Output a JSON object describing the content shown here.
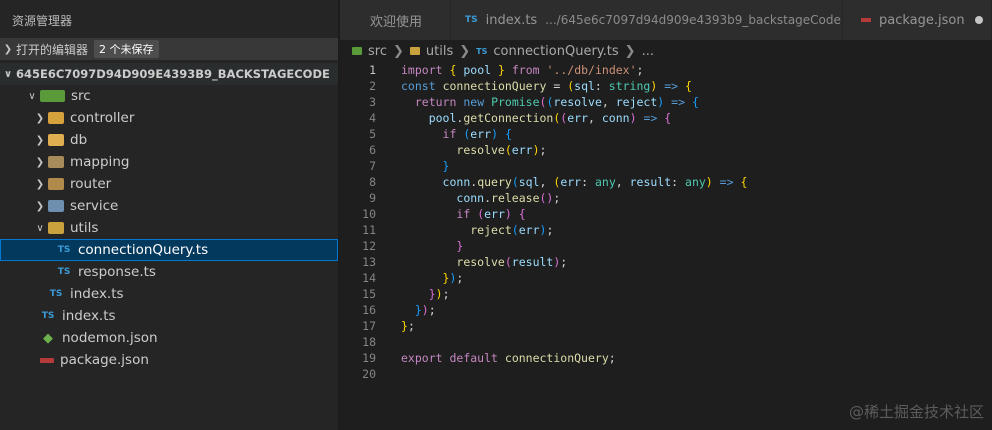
{
  "sidebar": {
    "title": "资源管理器",
    "open_editors": {
      "label": "打开的编辑器",
      "badge": "2 个未保存"
    },
    "root": {
      "label": "645E6C7097D94D909E4393B9_BACKSTAGECODE"
    },
    "tree": [
      {
        "label": "src"
      },
      {
        "label": "controller"
      },
      {
        "label": "db"
      },
      {
        "label": "mapping"
      },
      {
        "label": "router"
      },
      {
        "label": "service"
      },
      {
        "label": "utils"
      },
      {
        "label": "connectionQuery.ts"
      },
      {
        "label": "response.ts"
      },
      {
        "label": "index.ts"
      },
      {
        "label": "index.ts"
      },
      {
        "label": "nodemon.json"
      },
      {
        "label": "package.json"
      }
    ]
  },
  "tabs": [
    {
      "label": "欢迎使用"
    },
    {
      "label": "index.ts",
      "path": ".../645e6c7097d94d909e4393b9_backstageCode"
    },
    {
      "label": "package.json"
    }
  ],
  "breadcrumb": {
    "a": "src",
    "b": "utils",
    "c": "connectionQuery.ts",
    "d": "..."
  },
  "code": {
    "line_numbers": [
      "1",
      "2",
      "3",
      "4",
      "5",
      "6",
      "7",
      "8",
      "9",
      "10",
      "11",
      "12",
      "13",
      "14",
      "15",
      "16",
      "17",
      "18",
      "19",
      "20"
    ]
  },
  "watermark": "@稀土掘金技术社区"
}
